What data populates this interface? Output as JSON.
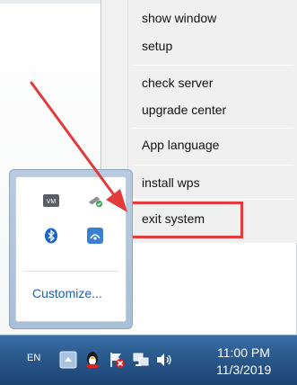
{
  "menu": {
    "items": [
      {
        "label": "show window"
      },
      {
        "label": "setup"
      },
      {
        "label": "check server"
      },
      {
        "label": "upgrade center"
      },
      {
        "label": "App language"
      },
      {
        "label": "install wps"
      },
      {
        "label": "exit system"
      }
    ]
  },
  "tray_popup": {
    "customize_label": "Customize...",
    "icons": [
      "vm-app-icon",
      "usb-drive-icon",
      "bluetooth-icon",
      "network-app-icon"
    ]
  },
  "taskbar": {
    "language": "EN",
    "time": "11:00 PM",
    "date": "11/3/2019",
    "icons": [
      "show-hidden-icons-button",
      "penguin-icon",
      "flag-warning-icon",
      "network-icon",
      "volume-icon"
    ]
  },
  "annotation": {
    "arrow_color": "#e23b3b",
    "highlight_color": "#e23b3b"
  }
}
